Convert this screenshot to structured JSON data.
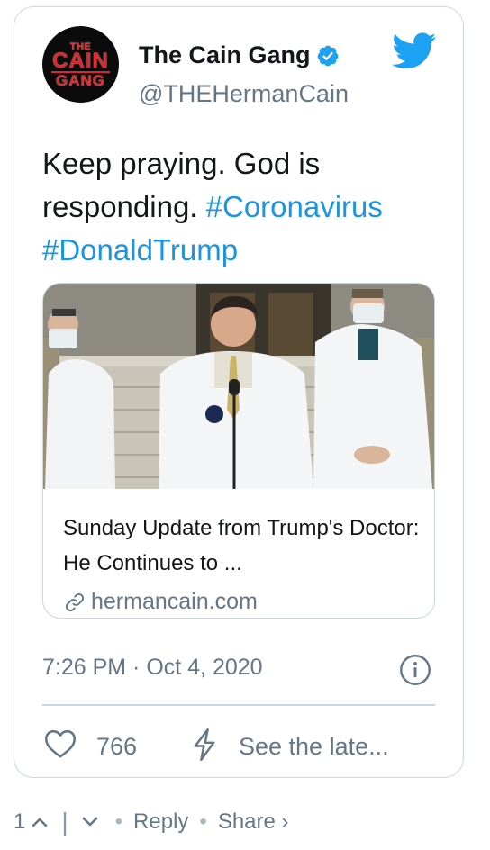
{
  "author": {
    "display_name": "The Cain Gang",
    "handle": "@THEHermanCain",
    "avatar_text": [
      "THE",
      "CAIN",
      "GANG"
    ],
    "verified": true
  },
  "tweet": {
    "text_plain": "Keep praying. God is responding.",
    "hashtags": [
      "#Coronavirus",
      "#DonaldTrump"
    ],
    "timestamp": "7:26 PM · Oct 4, 2020"
  },
  "link_card": {
    "title": "Sunday Update from Trump's Doctor: He Continues to ...",
    "domain": "hermancain.com"
  },
  "actions": {
    "like_count": "766",
    "see_latest_label": "See the late..."
  },
  "footer": {
    "count": "1",
    "reply_label": "Reply",
    "share_label": "Share ›"
  },
  "colors": {
    "accent": "#1b95e0",
    "twitter_blue": "#1da1f2",
    "muted": "#657786",
    "border": "#ccd6dd",
    "brand_red": "#e0262b"
  },
  "icons": [
    "verified-badge-icon",
    "twitter-bird-icon",
    "link-icon",
    "info-icon",
    "heart-icon",
    "bolt-icon",
    "chevron-up-icon",
    "chevron-down-icon"
  ]
}
